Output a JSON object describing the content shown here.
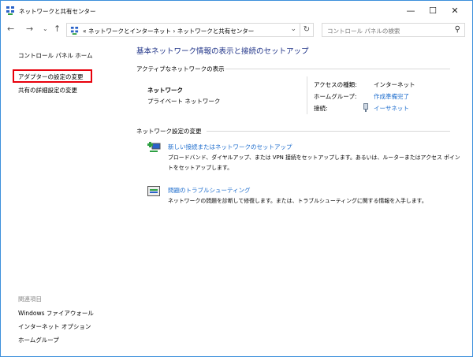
{
  "window": {
    "title": "ネットワークと共有センター",
    "minimize": "—",
    "maximize": "☐",
    "close": "✕"
  },
  "nav": {
    "back": "←",
    "forward": "→",
    "recent": "⌄",
    "up": "↑",
    "refresh": "↻",
    "dropdown": "⌄"
  },
  "address": {
    "crumbs": "«  ネットワークとインターネット  ›  ネットワークと共有センター"
  },
  "search": {
    "placeholder": "コントロール パネルの検索",
    "icon": "⚲"
  },
  "sidebar": {
    "items": [
      {
        "label": "コントロール パネル ホーム"
      },
      {
        "label": "アダプターの設定の変更"
      },
      {
        "label": "共有の詳細設定の変更"
      }
    ],
    "related_heading": "関連項目",
    "related": [
      {
        "label": "Windows ファイアウォール"
      },
      {
        "label": "インターネット オプション"
      },
      {
        "label": "ホームグループ"
      }
    ]
  },
  "main": {
    "title": "基本ネットワーク情報の表示と接続のセットアップ",
    "active_heading": "アクティブなネットワークの表示",
    "network": {
      "name": "ネットワーク",
      "type": "プライベート ネットワーク",
      "access_label": "アクセスの種類:",
      "access_value": "インターネット",
      "homegroup_label": "ホームグループ:",
      "homegroup_value": "作成準備完了",
      "connection_label": "接続:",
      "connection_value": "イーサネット"
    },
    "change_heading": "ネットワーク設定の変更",
    "tasks": [
      {
        "title": "新しい接続またはネットワークのセットアップ",
        "desc1": "ブロードバンド、ダイヤルアップ、または VPN 接続をセットアップします。あるいは、ルーターまたはアクセス ポイン",
        "desc2": "トをセットアップします。"
      },
      {
        "title": "問題のトラブルシューティング",
        "desc1": "ネットワークの問題を診断して修復します。または、トラブルシューティングに関する情報を入手します。"
      }
    ]
  }
}
